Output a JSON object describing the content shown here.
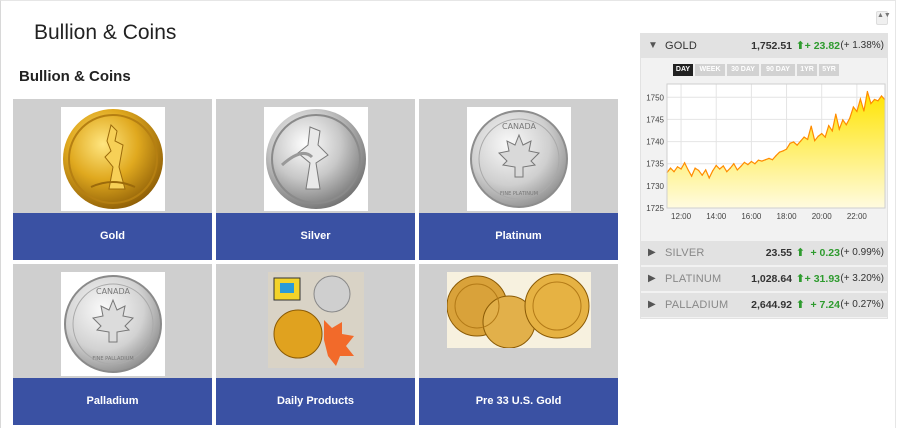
{
  "page": {
    "title": "Bullion & Coins",
    "section_title": "Bullion & Coins",
    "scroll_glyph": "▲▼"
  },
  "tiles": [
    {
      "label": "Gold",
      "icon": "gold-eagle-coin-image"
    },
    {
      "label": "Silver",
      "icon": "silver-eagle-coin-image"
    },
    {
      "label": "Platinum",
      "icon": "platinum-maple-leaf-coin-image"
    },
    {
      "label": "Palladium",
      "icon": "palladium-maple-leaf-coin-image"
    },
    {
      "label": "Daily Products",
      "icon": "daily-products-image"
    },
    {
      "label": "Pre 33 U.S. Gold",
      "icon": "pre33-gold-coins-image"
    }
  ],
  "coin_text": {
    "canada": "CANADA",
    "fine_pt": "FINE PLATINUM",
    "fine_pd": "FINE PALLADIUM"
  },
  "widget": {
    "rows": [
      {
        "name": "GOLD",
        "price": "1,752.51",
        "change": "+ 23.82",
        "pct": "(+ 1.38%)",
        "expanded": true,
        "tri": "▼",
        "arrow": "⬆"
      },
      {
        "name": "SILVER",
        "price": "23.55",
        "change": "+ 0.23",
        "pct": "(+ 0.99%)",
        "expanded": false,
        "tri": "▶",
        "arrow": "⬆"
      },
      {
        "name": "PLATINUM",
        "price": "1,028.64",
        "change": "+ 31.93",
        "pct": "(+ 3.20%)",
        "expanded": false,
        "tri": "▶",
        "arrow": "⬆"
      },
      {
        "name": "PALLADIUM",
        "price": "2,644.92",
        "change": "+ 7.24",
        "pct": "(+ 0.27%)",
        "expanded": false,
        "tri": "▶",
        "arrow": "⬆"
      }
    ],
    "ranges": [
      "DAY",
      "WEEK",
      "30 DAY",
      "90 DAY",
      "1YR",
      "5YR"
    ],
    "active_range": "DAY",
    "colors": {
      "up": "#2e9b2e",
      "line": "#ff8c00",
      "fill_top": "#ffe400",
      "fill_bottom": "#fffbe0"
    }
  },
  "chart_data": {
    "type": "area",
    "title": "",
    "xlabel": "",
    "ylabel": "",
    "x_ticks": [
      "12:00",
      "14:00",
      "16:00",
      "18:00",
      "20:00",
      "22:00"
    ],
    "y_ticks": [
      1725,
      1730,
      1735,
      1740,
      1745,
      1750
    ],
    "xlim": [
      11.2,
      23.6
    ],
    "ylim": [
      1725,
      1753
    ],
    "grid": true,
    "series": [
      {
        "x": [
          11.2,
          11.4,
          11.6,
          11.8,
          12.0,
          12.2,
          12.4,
          12.6,
          12.8,
          13.0,
          13.2,
          13.4,
          13.6,
          13.8,
          14.0,
          14.2,
          14.4,
          14.6,
          14.8,
          15.0,
          15.2,
          15.4,
          15.6,
          15.8,
          16.0,
          16.2,
          16.4,
          16.6,
          16.8,
          17.0,
          17.2,
          17.4,
          17.6,
          17.8,
          18.0,
          18.2,
          18.4,
          18.6,
          18.8,
          19.0,
          19.2,
          19.4,
          19.6,
          19.8,
          20.0,
          20.2,
          20.4,
          20.6,
          20.8,
          21.0,
          21.2,
          21.4,
          21.6,
          21.8,
          22.0,
          22.2,
          22.4,
          22.6,
          22.8,
          23.0,
          23.2,
          23.4,
          23.6
        ],
        "values": [
          1733.0,
          1734.0,
          1733.2,
          1734.3,
          1733.8,
          1735.2,
          1733.6,
          1732.2,
          1734.0,
          1733.5,
          1732.4,
          1733.6,
          1731.8,
          1733.4,
          1734.6,
          1733.8,
          1734.5,
          1733.2,
          1734.0,
          1735.0,
          1733.6,
          1734.4,
          1735.3,
          1734.8,
          1735.5,
          1735.0,
          1735.8,
          1735.6,
          1735.9,
          1736.2,
          1735.9,
          1736.8,
          1737.6,
          1737.9,
          1738.3,
          1739.6,
          1739.9,
          1739.2,
          1740.1,
          1741.0,
          1740.5,
          1743.5,
          1740.2,
          1741.2,
          1741.8,
          1741.0,
          1743.6,
          1742.4,
          1746.2,
          1742.8,
          1744.9,
          1743.8,
          1745.3,
          1747.8,
          1746.8,
          1749.6,
          1746.9,
          1751.3,
          1748.6,
          1749.5,
          1749.2,
          1750.3,
          1749.4
        ]
      }
    ]
  }
}
